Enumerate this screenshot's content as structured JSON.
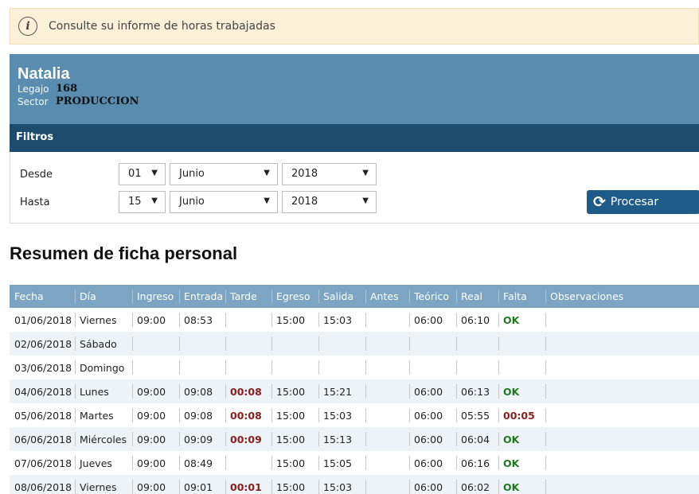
{
  "alert": {
    "icon": "info-icon",
    "text": "Consulte su informe de horas trabajadas"
  },
  "profile": {
    "name": "Natalia",
    "legajo_label": "Legajo",
    "legajo_value": "168",
    "sector_label": "Sector",
    "sector_value": "PRODUCCION"
  },
  "filters": {
    "title": "Filtros",
    "desde": {
      "label": "Desde",
      "day": "01",
      "month": "Junio",
      "year": "2018"
    },
    "hasta": {
      "label": "Hasta",
      "day": "15",
      "month": "Junio",
      "year": "2018"
    },
    "process_button": "Procesar"
  },
  "section_title": "Resumen de ficha personal",
  "colors": {
    "header_dark": "#1e4c6f",
    "profile_bg": "#5a8cb0",
    "table_head": "#7ca5c3",
    "late": "#8b1d1d",
    "ok": "#1e7a1e"
  },
  "table": {
    "columns": [
      "Fecha",
      "Día",
      "Ingreso",
      "Entrada",
      "Tarde",
      "Egreso",
      "Salida",
      "Antes",
      "Teórico",
      "Real",
      "Falta",
      "Observaciones"
    ],
    "rows": [
      {
        "fecha": "01/06/2018",
        "dia": "Viernes",
        "ingreso": "09:00",
        "entrada": "08:53",
        "tarde": "",
        "egreso": "15:00",
        "salida": "15:03",
        "antes": "",
        "teorico": "06:00",
        "real": "06:10",
        "falta": "OK",
        "obs": ""
      },
      {
        "fecha": "02/06/2018",
        "dia": "Sábado",
        "ingreso": "",
        "entrada": "",
        "tarde": "",
        "egreso": "",
        "salida": "",
        "antes": "",
        "teorico": "",
        "real": "",
        "falta": "",
        "obs": ""
      },
      {
        "fecha": "03/06/2018",
        "dia": "Domingo",
        "ingreso": "",
        "entrada": "",
        "tarde": "",
        "egreso": "",
        "salida": "",
        "antes": "",
        "teorico": "",
        "real": "",
        "falta": "",
        "obs": ""
      },
      {
        "fecha": "04/06/2018",
        "dia": "Lunes",
        "ingreso": "09:00",
        "entrada": "09:08",
        "tarde": "00:08",
        "egreso": "15:00",
        "salida": "15:21",
        "antes": "",
        "teorico": "06:00",
        "real": "06:13",
        "falta": "OK",
        "obs": ""
      },
      {
        "fecha": "05/06/2018",
        "dia": "Martes",
        "ingreso": "09:00",
        "entrada": "09:08",
        "tarde": "00:08",
        "egreso": "15:00",
        "salida": "15:03",
        "antes": "",
        "teorico": "06:00",
        "real": "05:55",
        "falta": "00:05",
        "obs": ""
      },
      {
        "fecha": "06/06/2018",
        "dia": "Miércoles",
        "ingreso": "09:00",
        "entrada": "09:09",
        "tarde": "00:09",
        "egreso": "15:00",
        "salida": "15:13",
        "antes": "",
        "teorico": "06:00",
        "real": "06:04",
        "falta": "OK",
        "obs": ""
      },
      {
        "fecha": "07/06/2018",
        "dia": "Jueves",
        "ingreso": "09:00",
        "entrada": "08:49",
        "tarde": "",
        "egreso": "15:00",
        "salida": "15:05",
        "antes": "",
        "teorico": "06:00",
        "real": "06:16",
        "falta": "OK",
        "obs": ""
      },
      {
        "fecha": "08/06/2018",
        "dia": "Viernes",
        "ingreso": "09:00",
        "entrada": "09:01",
        "tarde": "00:01",
        "egreso": "15:00",
        "salida": "15:03",
        "antes": "",
        "teorico": "06:00",
        "real": "06:02",
        "falta": "OK",
        "obs": ""
      }
    ]
  }
}
